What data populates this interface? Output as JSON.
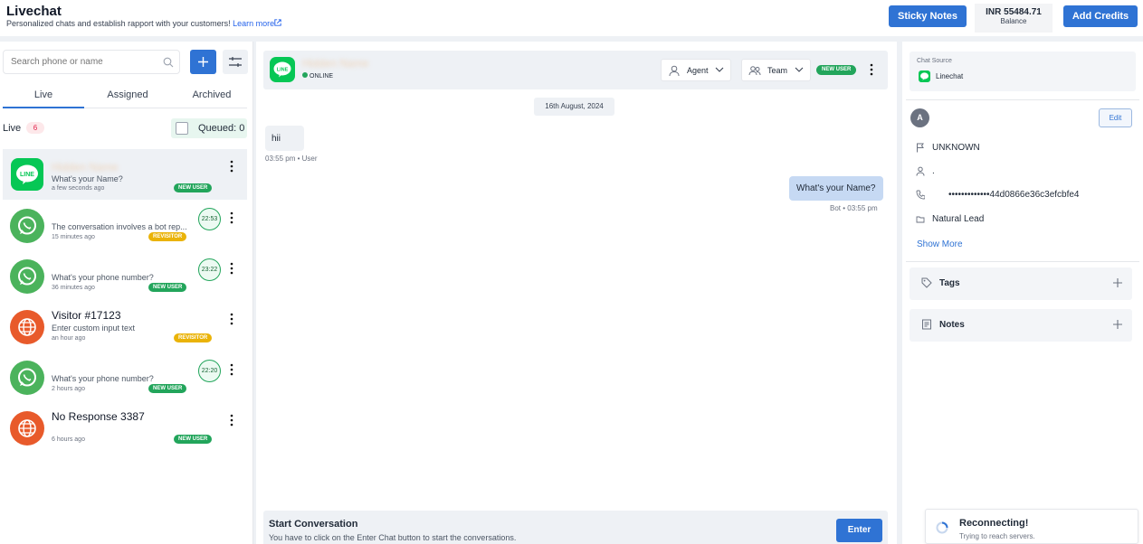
{
  "header": {
    "title": "Livechat",
    "subtitle": "Personalized chats and establish rapport with your customers!",
    "learn_more": "Learn more",
    "sticky_notes": "Sticky Notes",
    "balance_amount": "INR 55484.71",
    "balance_label": "Balance",
    "add_credits": "Add Credits"
  },
  "left": {
    "search_placeholder": "Search phone or name",
    "tabs": [
      "Live",
      "Assigned",
      "Archived"
    ],
    "live_label": "Live",
    "live_count": "6",
    "queued_label": "Queued: 0",
    "chats": [
      {
        "name": "",
        "message": "What's your Name?",
        "time": "a few seconds ago",
        "badge": "NEW USER",
        "channel": "line",
        "timer": ""
      },
      {
        "name": "",
        "message": "The conversation involves a bot rep...",
        "time": "15 minutes ago",
        "badge": "REVISITOR",
        "channel": "whatsapp",
        "timer": "22:53"
      },
      {
        "name": "",
        "message": "What's your phone number?",
        "time": "36 minutes ago",
        "badge": "NEW USER",
        "channel": "whatsapp",
        "timer": "23:22"
      },
      {
        "name": "Visitor #17123",
        "message": "Enter custom input text",
        "time": "an hour ago",
        "badge": "REVISITOR",
        "channel": "web",
        "timer": ""
      },
      {
        "name": "",
        "message": "What's your phone number?",
        "time": "2 hours ago",
        "badge": "NEW USER",
        "channel": "whatsapp",
        "timer": "22:20"
      },
      {
        "name": "No Response 3387",
        "message": "",
        "time": "6 hours ago",
        "badge": "NEW USER",
        "channel": "web",
        "timer": ""
      }
    ]
  },
  "chat": {
    "status": "ONLINE",
    "agent_label": "Agent",
    "team_label": "Team",
    "badge": "NEW USER",
    "date": "16th August, 2024",
    "incoming_text": "hii",
    "incoming_meta": "03:55 pm • User",
    "outgoing_text": "What's your Name?",
    "outgoing_meta": "Bot • 03:55 pm",
    "start_title": "Start Conversation",
    "start_sub": "You have to click on the Enter Chat button to start the conversations.",
    "enter_label": "Enter"
  },
  "details": {
    "source_label": "Chat Source",
    "source_value": "Linechat",
    "avatar_letter": "A",
    "edit_label": "Edit",
    "status": "UNKNOWN",
    "name": ".",
    "phone": "•••••••••••••44d0866e36c3efcbfe4",
    "lead": "Natural Lead",
    "show_more": "Show More",
    "tags_label": "Tags",
    "notes_label": "Notes"
  },
  "toast": {
    "title": "Reconnecting!",
    "subtitle": "Trying to reach servers."
  },
  "colors": {
    "primary": "#2f73d4",
    "line_green": "#06c755",
    "whatsapp_green": "#4bb35c",
    "web_orange": "#e85a2b",
    "new_user_badge": "#22a55b",
    "revisitor_badge": "#eab308"
  }
}
